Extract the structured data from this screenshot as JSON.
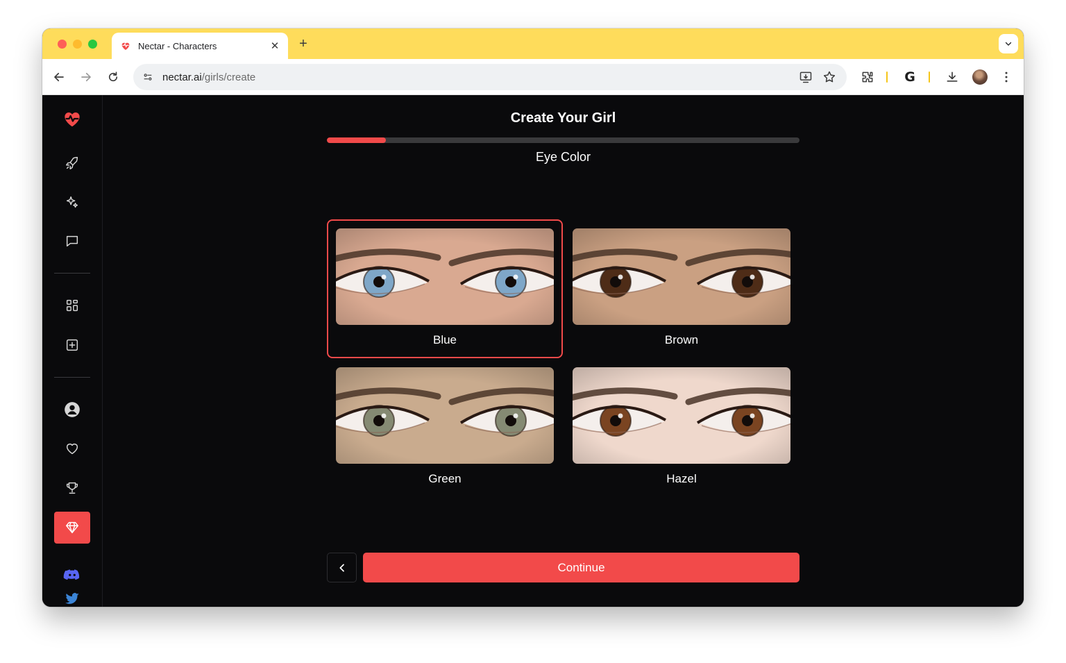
{
  "browser": {
    "tab_title": "Nectar - Characters",
    "url_host": "nectar.ai",
    "url_path": "/girls/create"
  },
  "page": {
    "title": "Create Your Girl",
    "step_title": "Eye Color",
    "progress": 0.125,
    "continue_label": "Continue"
  },
  "options": [
    {
      "label": "Blue",
      "selected": true,
      "iris_color": "#7fa7c8"
    },
    {
      "label": "Brown",
      "selected": false,
      "iris_color": "#4e2c17"
    },
    {
      "label": "Green",
      "selected": false,
      "iris_color": "#858a73"
    },
    {
      "label": "Hazel",
      "selected": false,
      "iris_color": "#7a4421"
    }
  ],
  "sidebar": {
    "icons": [
      "heart-pulse-icon",
      "rocket-icon",
      "sparkles-icon",
      "chat-icon",
      "grid-icon",
      "plus-square-icon",
      "user-icon",
      "heart-icon",
      "trophy-icon",
      "gem-icon",
      "discord-icon",
      "twitter-icon"
    ],
    "active": "gem-icon"
  },
  "colors": {
    "accent": "#f24a4a",
    "background": "#0a0a0c",
    "titlebar": "#fedc5b"
  }
}
